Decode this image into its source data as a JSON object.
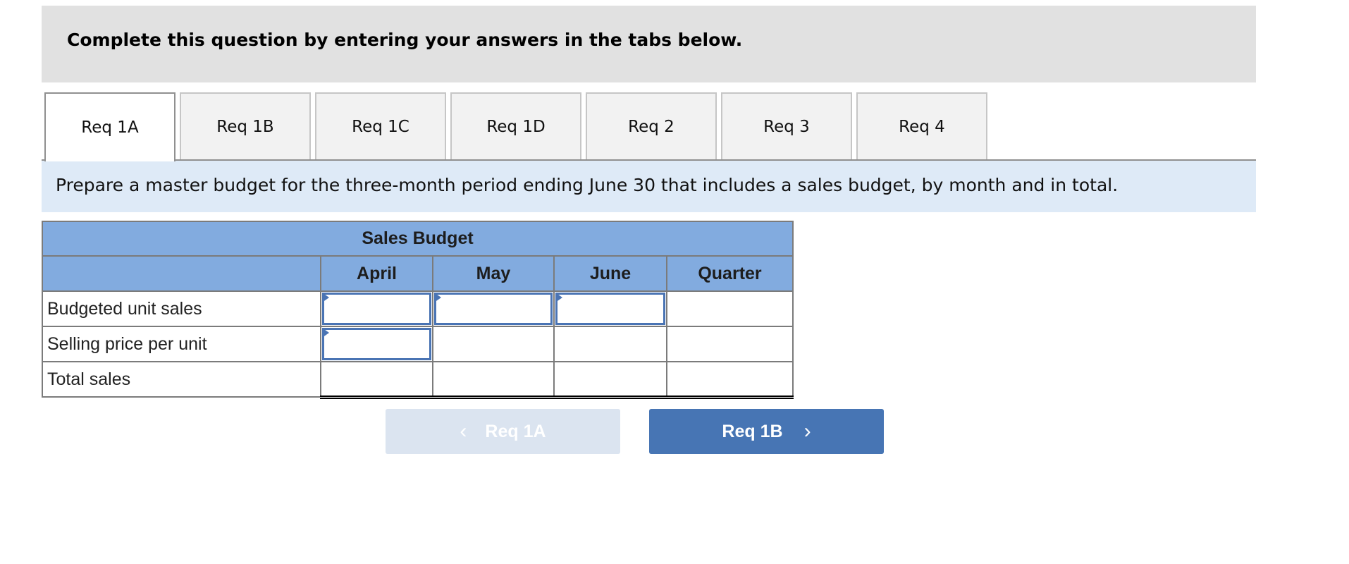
{
  "instruction": "Complete this question by entering your answers in the tabs below.",
  "tabs": [
    {
      "label": "Req 1A",
      "active": true
    },
    {
      "label": "Req 1B",
      "active": false
    },
    {
      "label": "Req 1C",
      "active": false
    },
    {
      "label": "Req 1D",
      "active": false
    },
    {
      "label": "Req 2",
      "active": false
    },
    {
      "label": "Req 3",
      "active": false
    },
    {
      "label": "Req 4",
      "active": false
    }
  ],
  "prompt": "Prepare a master budget for the three-month period ending June 30 that includes a sales budget, by month and in total.",
  "table": {
    "title": "Sales Budget",
    "columns": [
      "April",
      "May",
      "June",
      "Quarter"
    ],
    "rows": [
      {
        "label": "Budgeted unit sales",
        "values": [
          "",
          "",
          "",
          ""
        ]
      },
      {
        "label": "Selling price per unit",
        "values": [
          "",
          "",
          "",
          ""
        ]
      },
      {
        "label": "Total sales",
        "values": [
          "",
          "",
          "",
          ""
        ]
      }
    ]
  },
  "nav": {
    "prev_label": "Req 1A",
    "next_label": "Req 1B",
    "prev_icon": "‹",
    "next_icon": "›"
  },
  "colors": {
    "header_blue": "#82abdf",
    "input_border": "#4a74b4",
    "next_button": "#4775b4",
    "prev_button_disabled": "#dbe4f0",
    "prompt_bg": "#deeaf7",
    "instruction_bg": "#e1e1e1"
  }
}
